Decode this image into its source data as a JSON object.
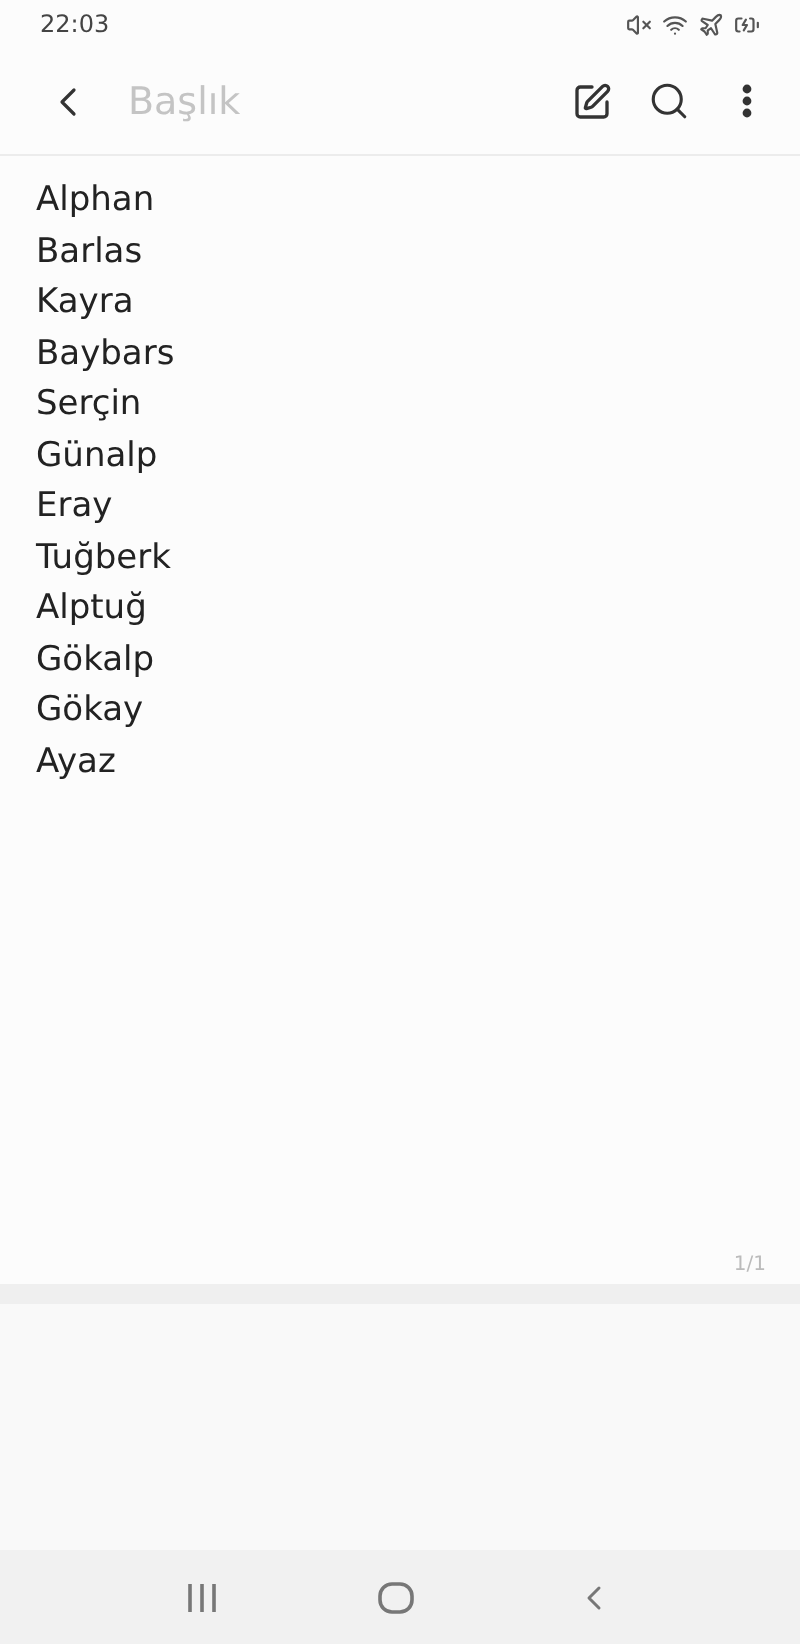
{
  "status_bar": {
    "time": "22:03"
  },
  "toolbar": {
    "title_placeholder": "Başlık"
  },
  "note": {
    "lines": [
      "Alphan",
      "Barlas",
      "Kayra",
      "Baybars",
      "Serçin",
      "Günalp",
      "Eray",
      "Tuğberk",
      "Alptuğ",
      "Gökalp",
      "Gökay",
      "Ayaz"
    ],
    "page_indicator": "1/1"
  }
}
